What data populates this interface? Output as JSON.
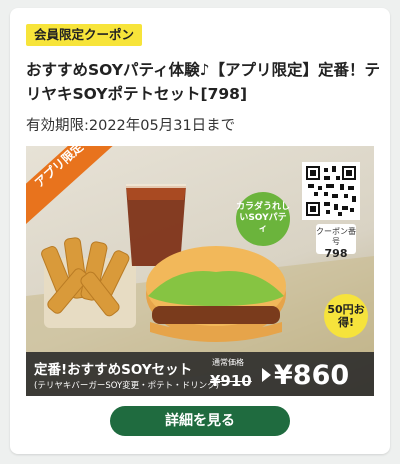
{
  "coupon": {
    "badge": "会員限定クーポン",
    "title": "おすすめSOYパティ体験♪【アプリ限定】定番！テリヤキSOYポテトセット[798]",
    "expiry": "有効期限:2022年05月31日まで"
  },
  "banner": {
    "ribbon": "アプリ限定",
    "green_badge": "カラダうれしいSOYパティ",
    "coupon_number_label": "クーポン番号",
    "coupon_number": "798",
    "discount_badge": "50円お得!",
    "set_name": "定番!おすすめSOYセット",
    "set_sub": "(テリヤキバーガーSOY変更・ポテト・ドリンク)",
    "regular_label": "通常価格",
    "regular_price": "¥910",
    "sale_price": "¥860"
  },
  "actions": {
    "details_button": "詳細を見る"
  }
}
